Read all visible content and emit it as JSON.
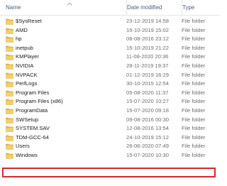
{
  "columns": {
    "name": "Name",
    "date_modified": "Date modified",
    "type": "Type"
  },
  "accent": {
    "highlight_border": "#d9262f",
    "folder_color": "#e8b84a"
  },
  "rows": [
    {
      "name": "$SysReset",
      "date": "23-12-2019 14:58",
      "type": "File folder",
      "icon": "folder-icon"
    },
    {
      "name": "AMD",
      "date": "16-10-2019 15:02",
      "type": "File folder",
      "icon": "folder-icon"
    },
    {
      "name": "hp",
      "date": "08-08-2016 23:12",
      "type": "File folder",
      "icon": "folder-icon"
    },
    {
      "name": "inetpub",
      "date": "15-10-2019 21:22",
      "type": "File folder",
      "icon": "folder-icon"
    },
    {
      "name": "KMPlayer",
      "date": "11-08-2020 20:36",
      "type": "File folder",
      "icon": "folder-icon"
    },
    {
      "name": "NVIDIA",
      "date": "28-11-2019 19:37",
      "type": "File folder",
      "icon": "folder-icon"
    },
    {
      "name": "NVPACK",
      "date": "01-12-2019 16:29",
      "type": "File folder",
      "icon": "folder-icon"
    },
    {
      "name": "PerfLogs",
      "date": "30-10-2015 12:54",
      "type": "File folder",
      "icon": "folder-icon"
    },
    {
      "name": "Program Files",
      "date": "05-08-2020 11:37",
      "type": "File folder",
      "icon": "folder-icon"
    },
    {
      "name": "Program Files (x86)",
      "date": "15-07-2020 10:27",
      "type": "File folder",
      "icon": "folder-icon"
    },
    {
      "name": "ProgramData",
      "date": "15-07-2020 09:18",
      "type": "File folder",
      "icon": "folder-icon"
    },
    {
      "name": "SWSetup",
      "date": "09-08-2016 00:30",
      "type": "File folder",
      "icon": "folder-icon"
    },
    {
      "name": "SYSTEM.SAV",
      "date": "12-08-2016 13:54",
      "type": "File folder",
      "icon": "folder-icon"
    },
    {
      "name": "TDM-GCC-64",
      "date": "24-10-2019 15:12",
      "type": "File folder",
      "icon": "folder-icon"
    },
    {
      "name": "Users",
      "date": "26-06-2020 07:49",
      "type": "File folder",
      "icon": "folder-icon",
      "highlighted": true
    },
    {
      "name": "Windows",
      "date": "15-07-2020 10:30",
      "type": "File folder",
      "icon": "folder-icon"
    }
  ]
}
